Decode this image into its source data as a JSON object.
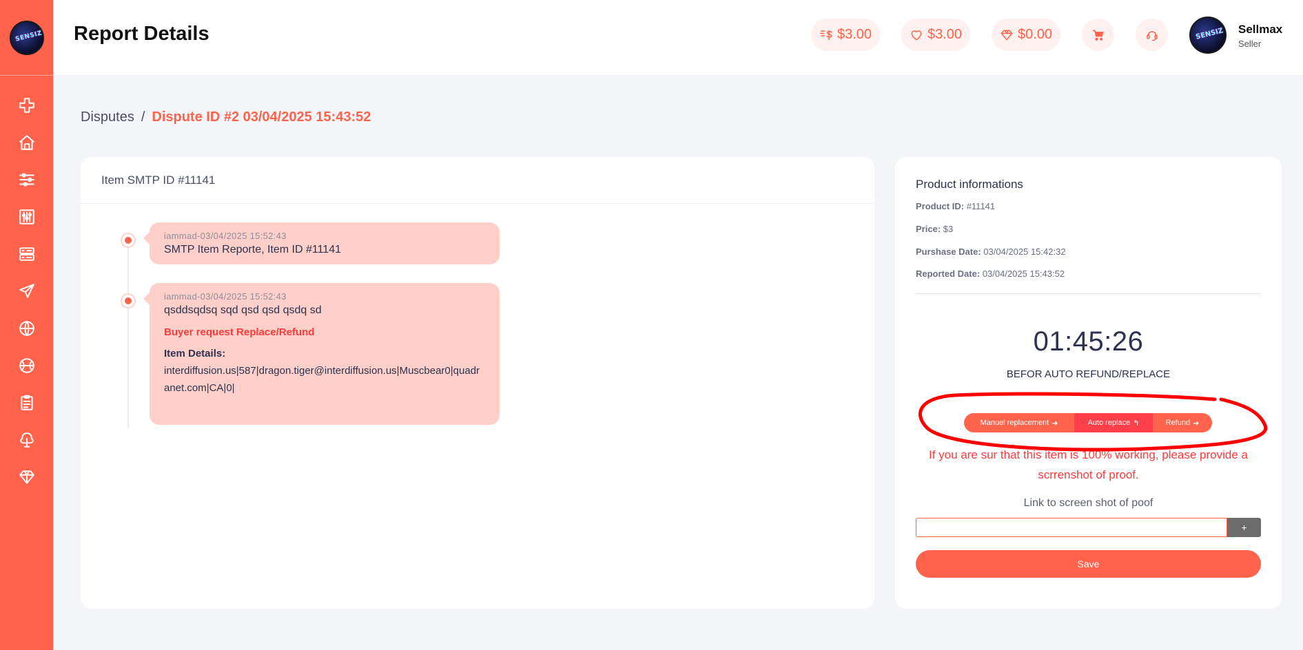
{
  "brand": {
    "logo_text": "SENSIZ",
    "accent": "#ff634c"
  },
  "sidebar": {
    "items": [
      {
        "name": "plus",
        "icon": "plus-icon"
      },
      {
        "name": "home",
        "icon": "home-icon"
      },
      {
        "name": "filters",
        "icon": "sliders-icon"
      },
      {
        "name": "tools",
        "icon": "equalizer-icon"
      },
      {
        "name": "server",
        "icon": "server-icon"
      },
      {
        "name": "send",
        "icon": "send-icon"
      },
      {
        "name": "web",
        "icon": "globe-icon"
      },
      {
        "name": "sports",
        "icon": "ball-icon"
      },
      {
        "name": "reports",
        "icon": "clipboard-icon"
      },
      {
        "name": "nature",
        "icon": "tree-icon"
      },
      {
        "name": "premium",
        "icon": "diamond-icon"
      }
    ]
  },
  "header": {
    "title": "Report Details",
    "balance_1": "$3.00",
    "balance_2": "$3.00",
    "balance_3": "$0.00",
    "user_name": "Sellmax",
    "user_role": "Seller"
  },
  "breadcrumb": {
    "parent": "Disputes",
    "separator": "/",
    "current": "Dispute ID #2 03/04/2025 15:43:52"
  },
  "item_card": {
    "title": "Item SMTP ID #11141",
    "messages": [
      {
        "meta": "iammad-03/04/2025 15:52:43",
        "text": "SMTP Item Reporte, Item ID #11141"
      },
      {
        "meta": "iammad-03/04/2025 15:52:43",
        "text": "qsddsqdsq sqd qsd qsd qsdq sd",
        "request": "Buyer request Replace/Refund",
        "details_label": "Item Details:",
        "details": "interdiffusion.us|587|dragon.tiger@interdiffusion.us|Muscbear0|quadranet.com|CA|0|"
      }
    ]
  },
  "product": {
    "title": "Product informations",
    "product_id_label": "Product ID:",
    "product_id": "#11141",
    "price_label": "Price:",
    "price": "$3",
    "purchase_label": "Purshase Date:",
    "purchase_date": "03/04/2025 15:42:32",
    "reported_label": "Reported Date:",
    "reported_date": "03/04/2025 15:43:52",
    "timer": "01:45:26",
    "timer_label": "BEFOR AUTO REFUND/REPLACE",
    "actions": {
      "manual": "Manuel replacement",
      "auto": "Auto replace",
      "refund": "Refund"
    },
    "warning": "If you are sur that this item is 100% working, please provide a scrrenshot of proof.",
    "link_label": "Link to screen shot of poof",
    "link_value": "",
    "add_label": "+",
    "save_label": "Save"
  }
}
